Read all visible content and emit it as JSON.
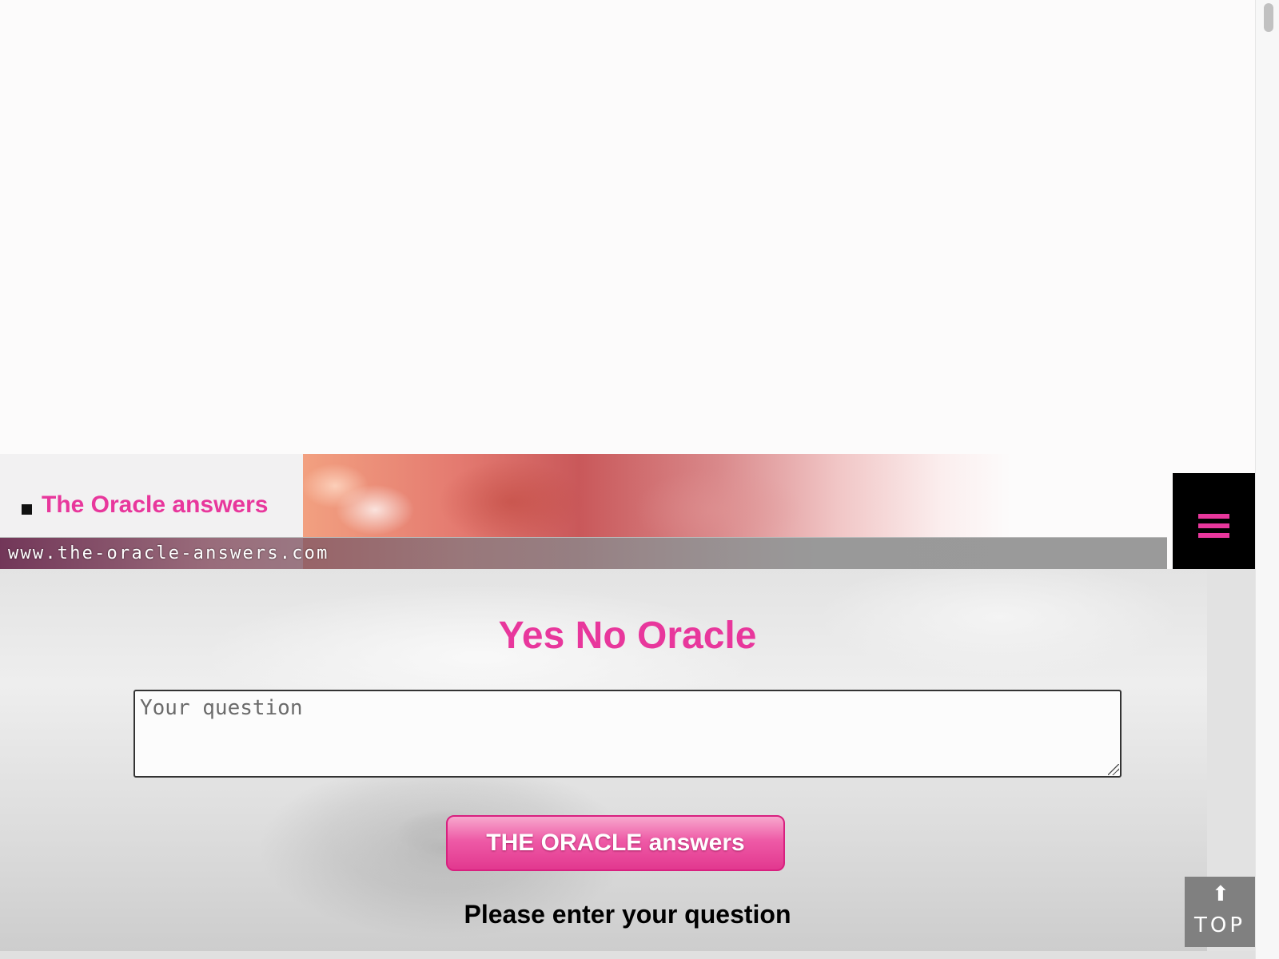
{
  "header": {
    "site_title": "The Oracle answers",
    "url": "www.the-oracle-answers.com",
    "menu_icon": "hamburger-menu-icon",
    "bullet_icon": "square-bullet-icon"
  },
  "main": {
    "title": "Yes No Oracle",
    "question_input": {
      "value": "",
      "placeholder": "Your question"
    },
    "submit_label": "THE ORACLE answers",
    "status": "Please enter your question"
  },
  "top_button": {
    "icon": "up-arrow-icon",
    "label": "TOP"
  },
  "colors": {
    "accent": "#e8379c",
    "menu_bg": "#000000",
    "top_bg": "#808080"
  }
}
